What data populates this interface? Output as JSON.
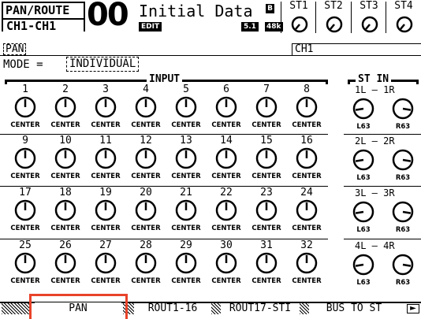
{
  "header": {
    "title_line1": "PAN/ROUTE",
    "title_line2": "CH1-CH1",
    "scene_number": "00",
    "scene_name": "Initial Data",
    "edit_badge": "EDIT",
    "b_badge": "B",
    "version_badge": "5.1",
    "fs_badge": "48k",
    "st_labels": [
      "ST1",
      "ST2",
      "ST3",
      "ST4"
    ]
  },
  "pan_tag": "PAN",
  "channel_field": "CH1",
  "mode": {
    "label": "MODE =",
    "value": "INDIVIDUAL"
  },
  "input_group_label": "INPUT",
  "st_in_group_label": "ST  IN",
  "inputs": [
    {
      "ch": "1",
      "pan": "CENTER"
    },
    {
      "ch": "2",
      "pan": "CENTER"
    },
    {
      "ch": "3",
      "pan": "CENTER"
    },
    {
      "ch": "4",
      "pan": "CENTER"
    },
    {
      "ch": "5",
      "pan": "CENTER"
    },
    {
      "ch": "6",
      "pan": "CENTER"
    },
    {
      "ch": "7",
      "pan": "CENTER"
    },
    {
      "ch": "8",
      "pan": "CENTER"
    },
    {
      "ch": "9",
      "pan": "CENTER"
    },
    {
      "ch": "10",
      "pan": "CENTER"
    },
    {
      "ch": "11",
      "pan": "CENTER"
    },
    {
      "ch": "12",
      "pan": "CENTER"
    },
    {
      "ch": "13",
      "pan": "CENTER"
    },
    {
      "ch": "14",
      "pan": "CENTER"
    },
    {
      "ch": "15",
      "pan": "CENTER"
    },
    {
      "ch": "16",
      "pan": "CENTER"
    },
    {
      "ch": "17",
      "pan": "CENTER"
    },
    {
      "ch": "18",
      "pan": "CENTER"
    },
    {
      "ch": "19",
      "pan": "CENTER"
    },
    {
      "ch": "20",
      "pan": "CENTER"
    },
    {
      "ch": "21",
      "pan": "CENTER"
    },
    {
      "ch": "22",
      "pan": "CENTER"
    },
    {
      "ch": "23",
      "pan": "CENTER"
    },
    {
      "ch": "24",
      "pan": "CENTER"
    },
    {
      "ch": "25",
      "pan": "CENTER"
    },
    {
      "ch": "26",
      "pan": "CENTER"
    },
    {
      "ch": "27",
      "pan": "CENTER"
    },
    {
      "ch": "28",
      "pan": "CENTER"
    },
    {
      "ch": "29",
      "pan": "CENTER"
    },
    {
      "ch": "30",
      "pan": "CENTER"
    },
    {
      "ch": "31",
      "pan": "CENTER"
    },
    {
      "ch": "32",
      "pan": "CENTER"
    }
  ],
  "st_in": [
    {
      "pair": "1L — 1R",
      "left": "L63",
      "right": "R63"
    },
    {
      "pair": "2L — 2R",
      "left": "L63",
      "right": "R63"
    },
    {
      "pair": "3L — 3R",
      "left": "L63",
      "right": "R63"
    },
    {
      "pair": "4L — 4R",
      "left": "L63",
      "right": "R63"
    }
  ],
  "tabs": [
    "PAN",
    "ROUT1-16",
    "ROUT17-STI",
    "BUS TO ST"
  ],
  "tab_next_arrow": "►",
  "active_tab": "PAN"
}
